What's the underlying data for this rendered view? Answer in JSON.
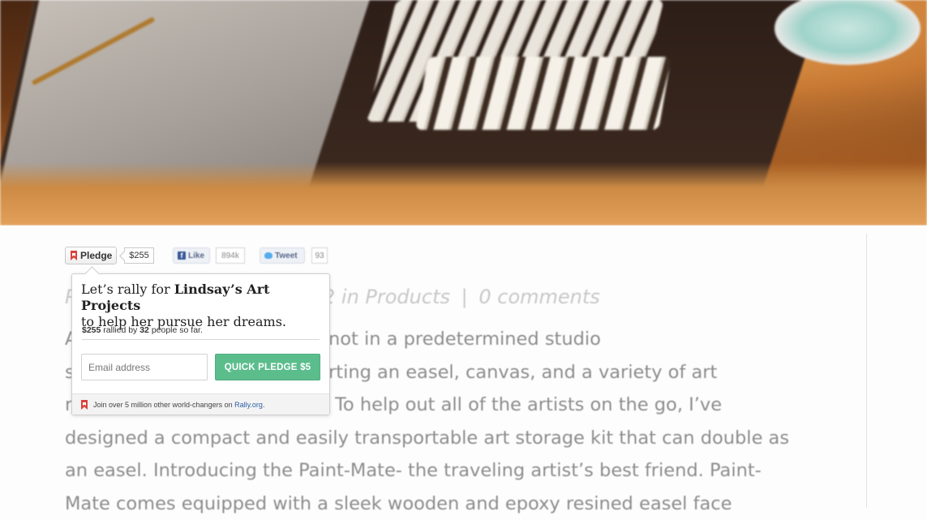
{
  "share": {
    "pledge_label": "Pledge",
    "pledge_amount": "$255",
    "like_label": "Like",
    "like_count": "894k",
    "tweet_label": "Tweet",
    "tweet_count": "93"
  },
  "meta": {
    "prefix": "P",
    "category_text": "2 in Products",
    "separator": "|",
    "comments": "0 comments"
  },
  "article": {
    "lines": [
      "A",
      "s",
      "r",
      "designed a compact and easily transportable art storage kit that can double as",
      "an easel. Introducing the Paint-Mate- the traveling artist’s best friend. Paint-",
      "Mate comes equipped with a sleek wooden and epoxy resined easel face"
    ],
    "right_fragments": [
      "not in a predetermined studio",
      "rting an easel, canvas, and a variety of art",
      "To help out all of the artists on the go, I’ve"
    ]
  },
  "popup": {
    "headline_pre": "Let’s rally for ",
    "headline_name": "Lindsay’s Art Projects",
    "headline_post": "to help her pursue her dreams.",
    "raised": "$255",
    "rallied_by_text": " rallied by ",
    "people_count": "32",
    "people_text": " people so far.",
    "email_placeholder": "Email address",
    "button_label": "QUICK PLEDGE $5",
    "footer_text": "Join over 5 million other world-changers on ",
    "footer_link": "Rally.org",
    "footer_period": "."
  },
  "colors": {
    "accent_green": "#5cbd8c",
    "rally_red": "#d9433b",
    "link_blue": "#2b5fa6"
  }
}
